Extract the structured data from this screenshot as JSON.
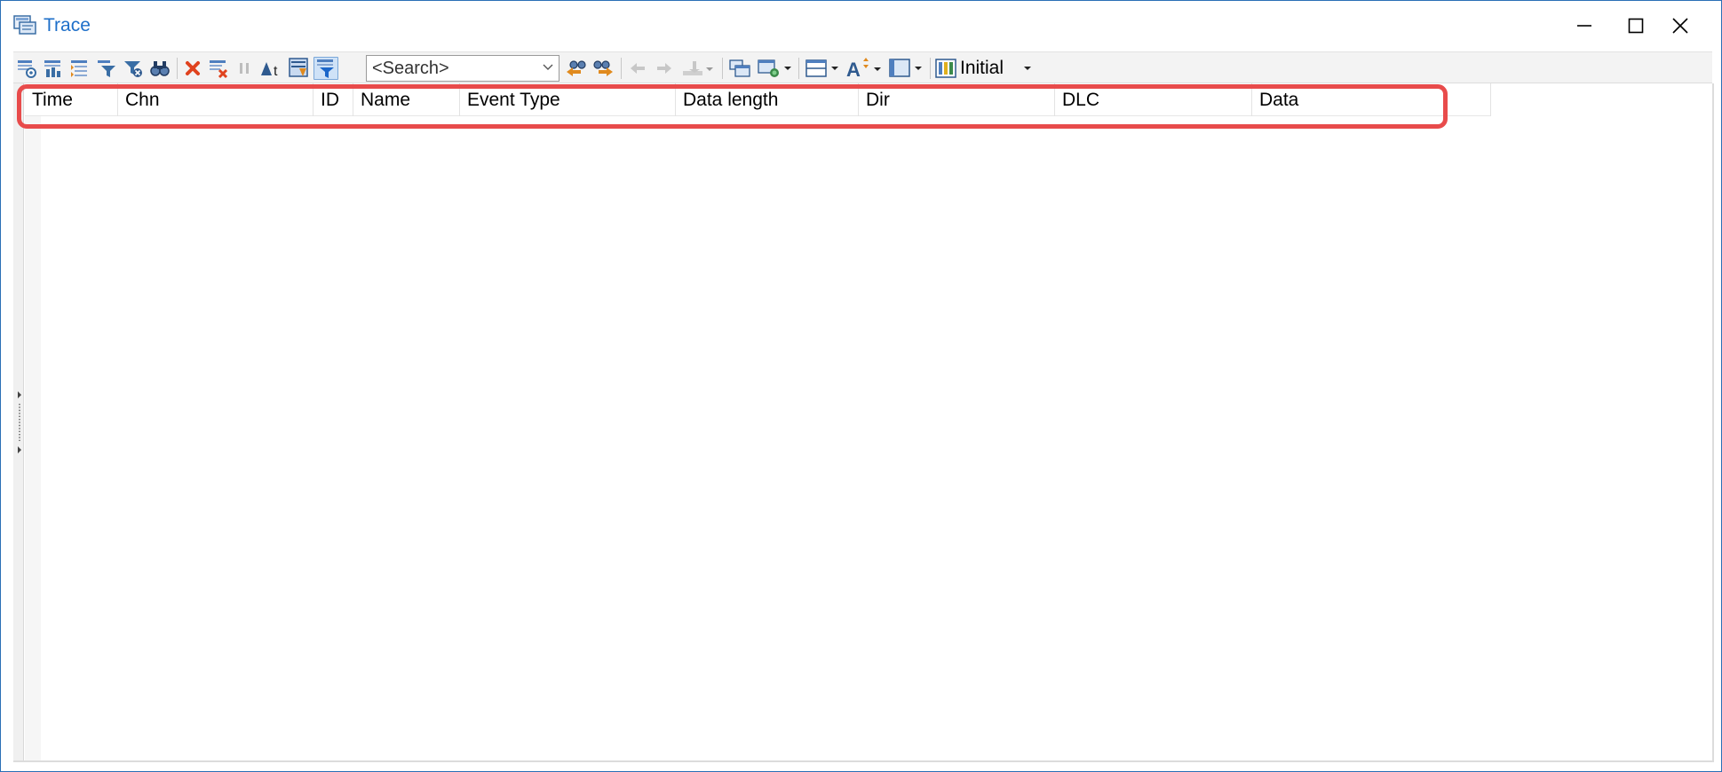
{
  "window": {
    "title": "Trace"
  },
  "toolbar": {
    "search_placeholder": "<Search>",
    "layout_label": "Initial"
  },
  "table": {
    "columns": [
      "Time",
      "Chn",
      "ID",
      "Name",
      "Event Type",
      "Data length",
      "Dir",
      "DLC",
      "Data"
    ],
    "rows": []
  },
  "colors": {
    "title_text": "#1e6fc9",
    "window_border": "#2b6fb6",
    "highlight": "#e84b4b",
    "toolbar_bg": "#f3f3f3"
  },
  "icons": {
    "toolbar": [
      "trace-settings-icon",
      "statistics-icon",
      "expand-collapse-icon",
      "filter-icon",
      "filter-remove-icon",
      "find-icon",
      "clear-icon",
      "clear-filter-icon",
      "pause-icon",
      "time-mode-icon",
      "scroll-icon",
      "filter-active-icon",
      "find-previous-icon",
      "find-next-icon",
      "nav-back-icon",
      "nav-forward-icon",
      "marker-icon",
      "column-layout-icon",
      "view-options-icon",
      "split-view-icon",
      "font-size-icon",
      "display-mode-icon",
      "layout-icon"
    ]
  }
}
